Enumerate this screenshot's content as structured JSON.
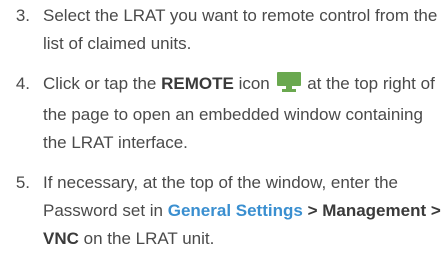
{
  "steps": [
    {
      "number": "3.",
      "text": "Select the LRAT you want to remote control from the list of claimed units."
    },
    {
      "number": "4.",
      "before": "Click or tap the ",
      "bold": "REMOTE",
      "after_bold": " icon",
      "icon": "remote-monitor-icon",
      "icon_color": "#6aa84f",
      "after_icon": " at the top right of the page to open an embedded window containing the LRAT interface."
    },
    {
      "number": "5.",
      "before": "If necessary, at the top of the window, enter the Password set in ",
      "link": "General Settings",
      "sep1": " > ",
      "bold1": "Man­agement",
      "sep2": " > ",
      "bold2": "VNC",
      "after": " on the LRAT unit."
    }
  ],
  "colors": {
    "text": "#4a4a4a",
    "link": "#3a8fd0",
    "icon": "#6aa84f"
  }
}
